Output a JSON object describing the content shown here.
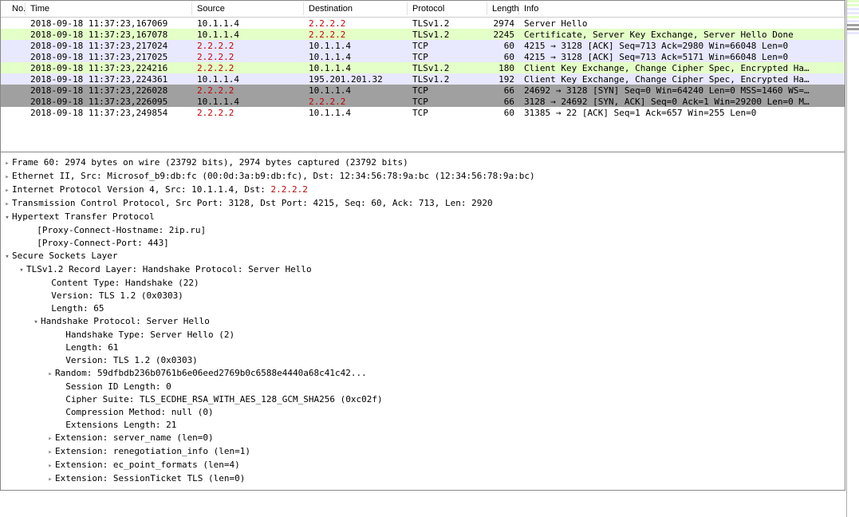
{
  "columns": {
    "no": "No.",
    "time": "Time",
    "source": "Source",
    "destination": "Destination",
    "protocol": "Protocol",
    "length": "Length",
    "info": "Info"
  },
  "packets": [
    {
      "time": "2018-09-18 11:37:23,167069",
      "src": "10.1.1.4",
      "dst": "2.2.2.2",
      "dst_red": true,
      "proto": "TLSv1.2",
      "len": "2974",
      "info": "Server Hello",
      "bg": "bg-white"
    },
    {
      "time": "2018-09-18 11:37:23,167078",
      "src": "10.1.1.4",
      "dst": "2.2.2.2",
      "dst_red": true,
      "proto": "TLSv1.2",
      "len": "2245",
      "info": "Certificate, Server Key Exchange, Server Hello Done",
      "bg": "bg-green"
    },
    {
      "time": "2018-09-18 11:37:23,217024",
      "src": "2.2.2.2",
      "src_red": true,
      "dst": "10.1.1.4",
      "proto": "TCP",
      "len": "60",
      "info": "4215 → 3128 [ACK] Seq=713 Ack=2980 Win=66048 Len=0",
      "bg": "bg-lav"
    },
    {
      "time": "2018-09-18 11:37:23,217025",
      "src": "2.2.2.2",
      "src_red": true,
      "dst": "10.1.1.4",
      "proto": "TCP",
      "len": "60",
      "info": "4215 → 3128 [ACK] Seq=713 Ack=5171 Win=66048 Len=0",
      "bg": "bg-lav"
    },
    {
      "time": "2018-09-18 11:37:23,224216",
      "src": "2.2.2.2",
      "src_red": true,
      "dst": "10.1.1.4",
      "proto": "TLSv1.2",
      "len": "180",
      "info": "Client Key Exchange, Change Cipher Spec, Encrypted Ha…",
      "bg": "bg-green"
    },
    {
      "time": "2018-09-18 11:37:23,224361",
      "src": "10.1.1.4",
      "dst": "195.201.201.32",
      "proto": "TLSv1.2",
      "len": "192",
      "info": "Client Key Exchange, Change Cipher Spec, Encrypted Ha…",
      "bg": "bg-lav"
    },
    {
      "time": "2018-09-18 11:37:23,226028",
      "src": "2.2.2.2",
      "src_red": true,
      "dst": "10.1.1.4",
      "proto": "TCP",
      "len": "66",
      "info": "24692 → 3128 [SYN] Seq=0 Win=64240 Len=0 MSS=1460 WS=…",
      "bg": "bg-gray"
    },
    {
      "time": "2018-09-18 11:37:23,226095",
      "src": "10.1.1.4",
      "dst": "2.2.2.2",
      "dst_red": true,
      "proto": "TCP",
      "len": "66",
      "info": "3128 → 24692 [SYN, ACK] Seq=0 Ack=1 Win=29200 Len=0 M…",
      "bg": "bg-gray"
    },
    {
      "time": "2018-09-18 11:37:23,249854",
      "src": "2.2.2.2",
      "src_red": true,
      "dst": "10.1.1.4",
      "proto": "TCP",
      "len": "60",
      "info": "31385 → 22 [ACK] Seq=1 Ack=657 Win=255 Len=0",
      "bg": "bg-white"
    }
  ],
  "tree": [
    {
      "ind": 0,
      "tw": "col",
      "txt": "Frame 60: 2974 bytes on wire (23792 bits), 2974 bytes captured (23792 bits)"
    },
    {
      "ind": 0,
      "tw": "col",
      "txt": "Ethernet II, Src: Microsof_b9:db:fc (00:0d:3a:b9:db:fc), Dst: 12:34:56:78:9a:bc (12:34:56:78:9a:bc)"
    },
    {
      "ind": 0,
      "tw": "col",
      "txt": "Internet Protocol Version 4, Src: 10.1.1.4, Dst: ",
      "extra": "2.2.2.2",
      "extra_red": true
    },
    {
      "ind": 0,
      "tw": "col",
      "txt": "Transmission Control Protocol, Src Port: 3128, Dst Port: 4215, Seq: 60, Ack: 713, Len: 2920"
    },
    {
      "ind": 0,
      "tw": "exp",
      "txt": "Hypertext Transfer Protocol"
    },
    {
      "ind": 1,
      "tw": "",
      "txt": "  [Proxy-Connect-Hostname: 2ip.ru]"
    },
    {
      "ind": 1,
      "tw": "",
      "txt": "  [Proxy-Connect-Port: 443]"
    },
    {
      "ind": 0,
      "tw": "exp",
      "txt": "Secure Sockets Layer"
    },
    {
      "ind": 1,
      "tw": "exp",
      "txt": "TLSv1.2 Record Layer: Handshake Protocol: Server Hello"
    },
    {
      "ind": 2,
      "tw": "",
      "txt": "  Content Type: Handshake (22)"
    },
    {
      "ind": 2,
      "tw": "",
      "txt": "  Version: TLS 1.2 (0x0303)"
    },
    {
      "ind": 2,
      "tw": "",
      "txt": "  Length: 65"
    },
    {
      "ind": 2,
      "tw": "exp",
      "txt": "Handshake Protocol: Server Hello"
    },
    {
      "ind": 3,
      "tw": "",
      "txt": "  Handshake Type: Server Hello (2)"
    },
    {
      "ind": 3,
      "tw": "",
      "txt": "  Length: 61"
    },
    {
      "ind": 3,
      "tw": "",
      "txt": "  Version: TLS 1.2 (0x0303)"
    },
    {
      "ind": 3,
      "tw": "col",
      "txt": "Random: 59dfbdb236b0761b6e06eed2769b0c6588e4440a68c41c42..."
    },
    {
      "ind": 3,
      "tw": "",
      "txt": "  Session ID Length: 0"
    },
    {
      "ind": 3,
      "tw": "",
      "txt": "  Cipher Suite: TLS_ECDHE_RSA_WITH_AES_128_GCM_SHA256 (0xc02f)"
    },
    {
      "ind": 3,
      "tw": "",
      "txt": "  Compression Method: null (0)"
    },
    {
      "ind": 3,
      "tw": "",
      "txt": "  Extensions Length: 21"
    },
    {
      "ind": 3,
      "tw": "col",
      "txt": "Extension: server_name (len=0)"
    },
    {
      "ind": 3,
      "tw": "col",
      "txt": "Extension: renegotiation_info (len=1)"
    },
    {
      "ind": 3,
      "tw": "col",
      "txt": "Extension: ec_point_formats (len=4)"
    },
    {
      "ind": 3,
      "tw": "col",
      "txt": "Extension: SessionTicket TLS (len=0)"
    }
  ]
}
